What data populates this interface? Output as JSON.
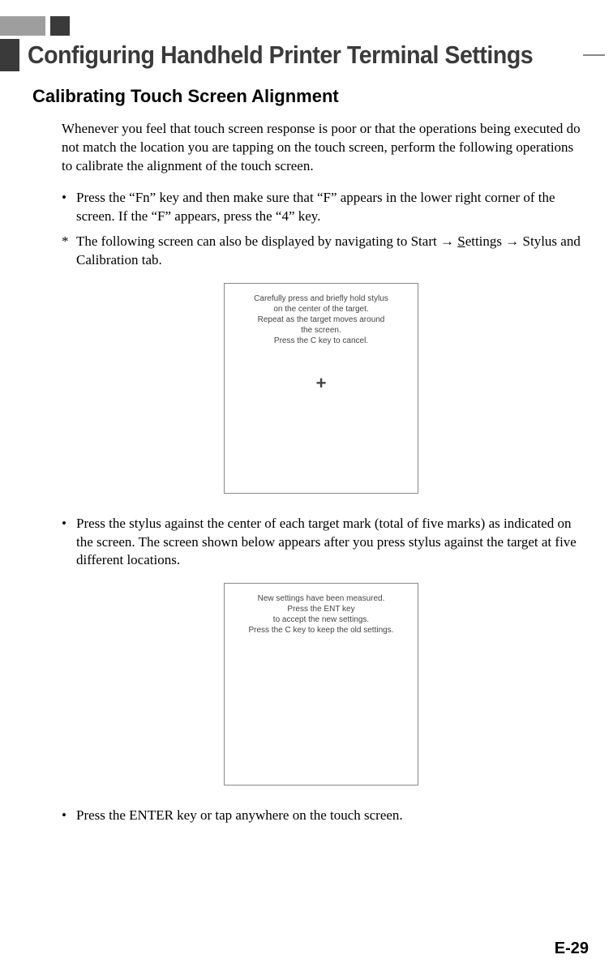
{
  "chapter_title": "Configuring Handheld Printer Terminal Settings",
  "section_title": "Calibrating Touch Screen Alignment",
  "intro_para": "Whenever you feel that touch screen response is poor or that the operations being executed do not match the location you are tapping on the touch screen, perform the following operations to calibrate the alignment of the touch screen.",
  "bullet1": "Press the “Fn” key and then make sure that “F” appears in the lower right corner of the screen. If the “F” appears, press the “4” key.",
  "note_prefix": "The following screen can also be displayed by navigating to Start → ",
  "note_underlined": "S",
  "note_suffix": "ettings → Stylus and Calibration tab.",
  "fig1": {
    "l1": "Carefully press and briefly hold stylus",
    "l2": "on the center of the target.",
    "l3": "Repeat as the target moves around",
    "l4": "the screen.",
    "l5": "Press the C key to cancel."
  },
  "bullet2": "Press the stylus against the center of each target mark (total of five marks) as indicated on the screen. The screen shown below appears after you press stylus against the target at five different locations.",
  "fig2": {
    "l1": "New settings have been measured.",
    "l2": "Press the ENT key",
    "l3": "to accept the new settings.",
    "l4": "Press the C key to keep the old settings."
  },
  "bullet3": "Press the ENTER key or tap anywhere on the touch screen.",
  "page_number": "E-29"
}
